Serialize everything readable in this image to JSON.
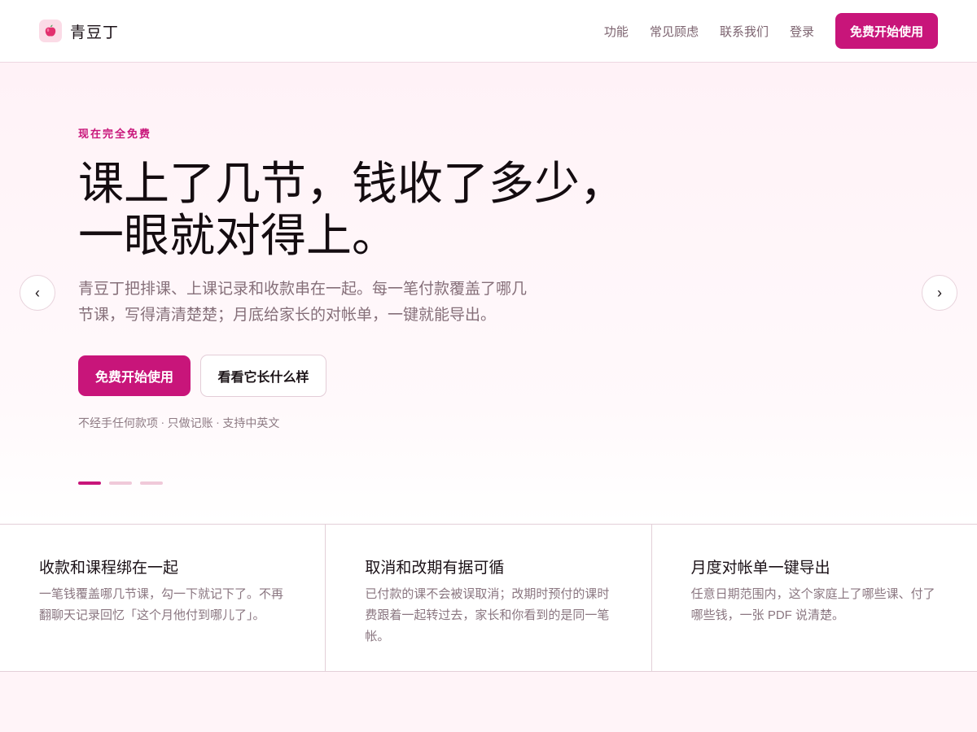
{
  "header": {
    "brand_name": "青豆丁",
    "logo_icon": "apple-icon",
    "nav": [
      "功能",
      "常见顾虑",
      "联系我们",
      "登录"
    ],
    "cta_label": "免费开始使用"
  },
  "hero": {
    "eyebrow": "现在完全免费",
    "headline_line1": "课上了几节，钱收了多少，",
    "headline_line2": "一眼就对得上。",
    "subtext": "青豆丁把排课、上课记录和收款串在一起。每一笔付款覆盖了哪几节课，写得清清楚楚；月底给家长的对帐单，一键就能导出。",
    "primary_label": "免费开始使用",
    "secondary_label": "看看它长什么样",
    "footnote": "不经手任何款项 · 只做记账 · 支持中英文",
    "prev_arrow": "‹",
    "next_arrow": "›",
    "slide_count": 3,
    "active_slide": 0
  },
  "features": [
    {
      "title": "收款和课程绑在一起",
      "desc": "一笔钱覆盖哪几节课，勾一下就记下了。不再翻聊天记录回忆「这个月他付到哪儿了」。"
    },
    {
      "title": "取消和改期有据可循",
      "desc": "已付款的课不会被误取消；改期时预付的课时费跟着一起转过去，家长和你看到的是同一笔帐。"
    },
    {
      "title": "月度对帐单一键导出",
      "desc": "任意日期范围内，这个家庭上了哪些课、付了哪些钱，一张 PDF 说清楚。"
    }
  ],
  "colors": {
    "accent": "#c8157a",
    "background": "#fff4f8",
    "muted_text": "#8a7680"
  }
}
